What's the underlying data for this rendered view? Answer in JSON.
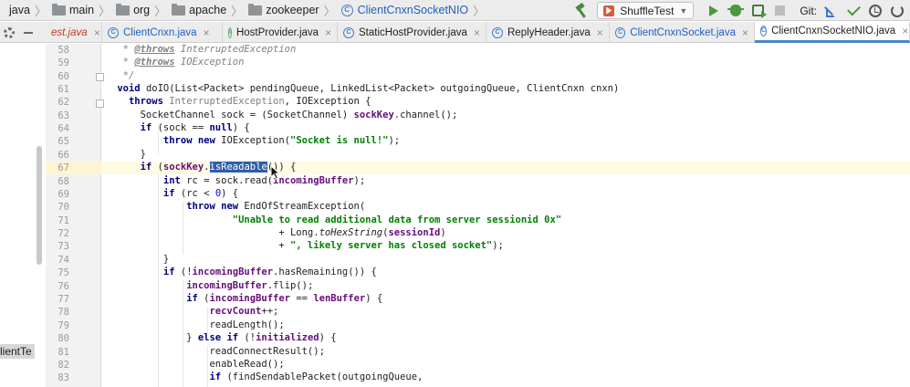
{
  "breadcrumbs": [
    {
      "label": "java",
      "icon": "folder-icon"
    },
    {
      "label": "main",
      "icon": "folder-icon"
    },
    {
      "label": "org",
      "icon": "folder-icon"
    },
    {
      "label": "apache",
      "icon": "folder-icon"
    },
    {
      "label": "zookeeper",
      "icon": "folder-icon"
    },
    {
      "label": "ClientCnxnSocketNIO",
      "icon": "class-icon"
    }
  ],
  "toolbar": {
    "run_config": "ShuffleTest",
    "git_label": "Git:"
  },
  "tabs": [
    {
      "label": "est.java",
      "partial": true
    },
    {
      "label": "ClientCnxn.java",
      "icon": "class-icon"
    },
    {
      "label": "HostProvider.java",
      "icon": "interface-icon"
    },
    {
      "label": "StaticHostProvider.java",
      "icon": "class-icon"
    },
    {
      "label": "ReplyHeader.java",
      "icon": "class-icon"
    },
    {
      "label": "ClientCnxnSocket.java",
      "icon": "class-icon"
    },
    {
      "label": "ClientCnxnSocketNIO.java",
      "icon": "class-icon",
      "active": true
    }
  ],
  "project_panel": {
    "label": "lientTe"
  },
  "editor": {
    "current_line": 67,
    "selection": "isReadable",
    "lines": [
      {
        "n": "58",
        "text": "  * @throws InterruptedException"
      },
      {
        "n": "59",
        "text": "  * @throws IOException"
      },
      {
        "n": "60",
        "text": "  */"
      },
      {
        "n": "61",
        "text": " void doIO(List<Packet> pendingQueue, LinkedList<Packet> outgoingQueue, ClientCnxn cnxn)"
      },
      {
        "n": "62",
        "text": "   throws InterruptedException, IOException {"
      },
      {
        "n": "63",
        "text": "     SocketChannel sock = (SocketChannel) sockKey.channel();"
      },
      {
        "n": "64",
        "text": "     if (sock == null) {"
      },
      {
        "n": "65",
        "text": "         throw new IOException(\"Socket is null!\");"
      },
      {
        "n": "66",
        "text": "     }"
      },
      {
        "n": "67",
        "text": "     if (sockKey.isReadable()) {"
      },
      {
        "n": "68",
        "text": "         int rc = sock.read(incomingBuffer);"
      },
      {
        "n": "69",
        "text": "         if (rc < 0) {"
      },
      {
        "n": "70",
        "text": "             throw new EndOfStreamException("
      },
      {
        "n": "71",
        "text": "                     \"Unable to read additional data from server sessionid 0x\""
      },
      {
        "n": "72",
        "text": "                             + Long.toHexString(sessionId)"
      },
      {
        "n": "73",
        "text": "                             + \", likely server has closed socket\");"
      },
      {
        "n": "74",
        "text": "         }"
      },
      {
        "n": "75",
        "text": "         if (!incomingBuffer.hasRemaining()) {"
      },
      {
        "n": "76",
        "text": "             incomingBuffer.flip();"
      },
      {
        "n": "77",
        "text": "             if (incomingBuffer == lenBuffer) {"
      },
      {
        "n": "78",
        "text": "                 recvCount++;"
      },
      {
        "n": "79",
        "text": "                 readLength();"
      },
      {
        "n": "80",
        "text": "             } else if (!initialized) {"
      },
      {
        "n": "81",
        "text": "                 readConnectResult();"
      },
      {
        "n": "82",
        "text": "                 enableRead();"
      },
      {
        "n": "83",
        "text": "                 if (findSendablePacket(outgoingQueue,"
      }
    ]
  }
}
